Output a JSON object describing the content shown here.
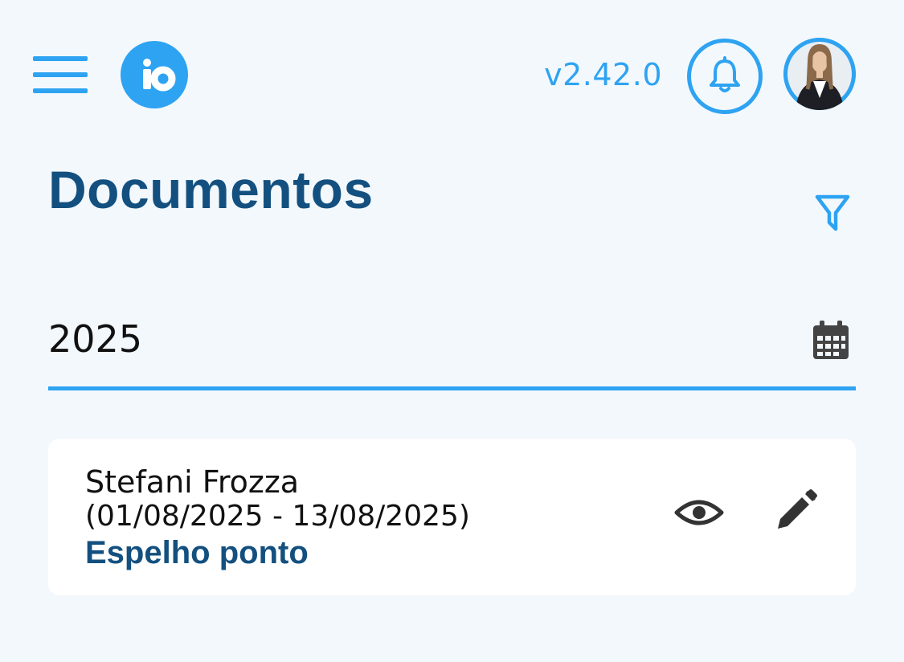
{
  "header": {
    "menu_icon": "hamburger-menu-icon",
    "logo_text": "io",
    "version": "v2.42.0",
    "notification_icon": "bell-icon",
    "avatar_icon": "user-avatar"
  },
  "page": {
    "title": "Documentos",
    "filter_icon": "funnel-filter-icon"
  },
  "year_field": {
    "value": "2025",
    "icon": "calendar-icon"
  },
  "documents": [
    {
      "name": "Stefani Frozza",
      "period": "(01/08/2025 - 13/08/2025)",
      "type": "Espelho ponto",
      "actions": [
        "eye-icon",
        "pencil-icon"
      ]
    }
  ],
  "colors": {
    "accent": "#2ea3f2",
    "title": "#13507f",
    "background": "#f3f8fd",
    "card": "#ffffff",
    "text": "#111111",
    "icon_dark": "#333333"
  }
}
